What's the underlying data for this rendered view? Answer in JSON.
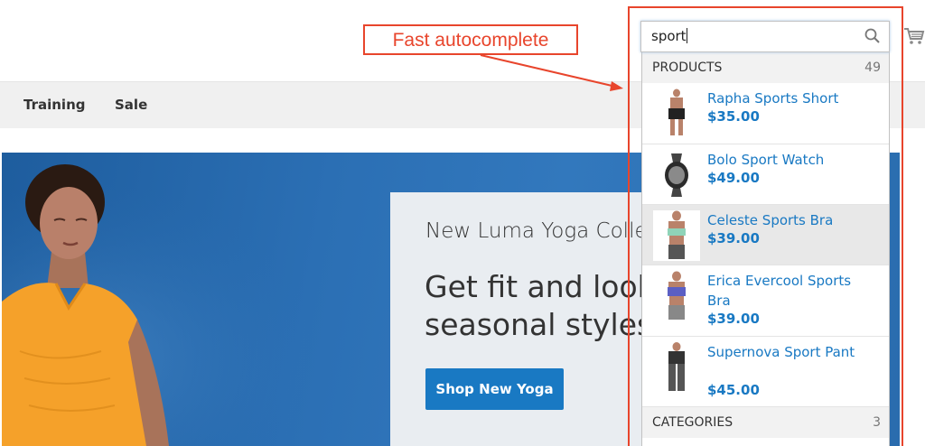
{
  "nav": {
    "items": [
      {
        "label": "Training"
      },
      {
        "label": "Sale"
      }
    ]
  },
  "annotation": {
    "label": "Fast autocomplete"
  },
  "search": {
    "query": "sport"
  },
  "autocomplete": {
    "products_header": "PRODUCTS",
    "products_count": "49",
    "products": [
      {
        "name": "Rapha Sports Short",
        "price": "$35.00"
      },
      {
        "name": "Bolo Sport Watch",
        "price": "$49.00"
      },
      {
        "name": "Celeste Sports Bra",
        "price": "$39.00"
      },
      {
        "name": "Erica Evercool Sports Bra",
        "price": "$39.00"
      },
      {
        "name": "Supernova Sport Pant",
        "price": "$45.00"
      }
    ],
    "categories_header": "CATEGORIES",
    "categories_count": "3"
  },
  "hero": {
    "subtitle": "New Luma Yoga Collection",
    "title_line1": "Get fit and look fab in new",
    "title_line2": "seasonal styles",
    "button_label": "Shop New Yoga"
  },
  "colors": {
    "accent": "#1979c3",
    "annotation": "#e8452c",
    "hero_blue": "#2b6fb4",
    "promo_bg": "#e9edf1"
  }
}
